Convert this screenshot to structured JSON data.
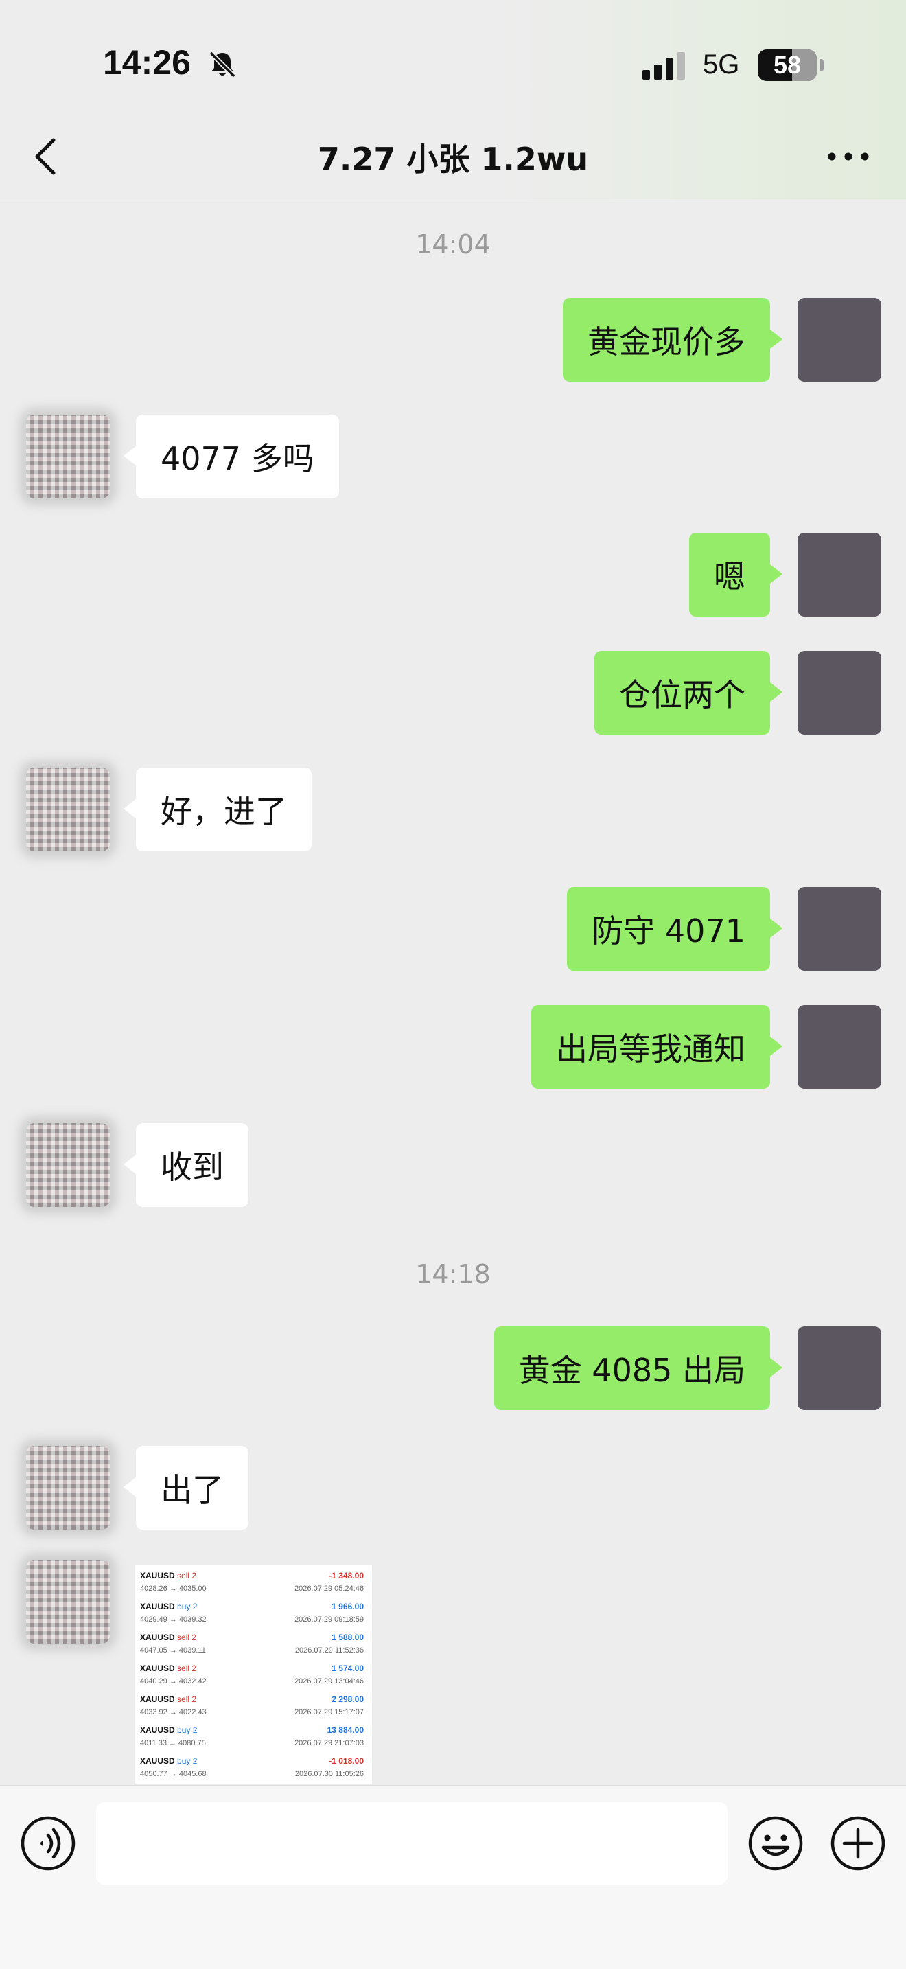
{
  "status_bar": {
    "time": "14:26",
    "network": "5G",
    "battery": "58",
    "battery_level": 0.58,
    "icons": [
      "bell-slash-icon",
      "signal-icon"
    ]
  },
  "nav": {
    "title": "7.27 小张 1.2wu",
    "back_icon": "chevron-left-icon",
    "more_icon": "ellipsis-icon"
  },
  "colors": {
    "self_bubble": "#95ec69",
    "other_bubble": "#ffffff",
    "background": "#ededed",
    "loss": "#d0312d",
    "profit": "#1e6fd9"
  },
  "timestamps": [
    "14:04",
    "14:18"
  ],
  "messages": [
    {
      "from": "self",
      "text": "黄金现价多"
    },
    {
      "from": "other",
      "text": "4077 多吗"
    },
    {
      "from": "self",
      "text": "嗯"
    },
    {
      "from": "self",
      "text": "仓位两个"
    },
    {
      "from": "other",
      "text": "好，进了"
    },
    {
      "from": "self",
      "text": "防守 4071"
    },
    {
      "from": "self",
      "text": "出局等我通知"
    },
    {
      "from": "other",
      "text": "收到"
    },
    {
      "from": "self",
      "text": "黄金 4085 出局"
    },
    {
      "from": "other",
      "text": "出了"
    }
  ],
  "trades": [
    {
      "symbol": "XAUUSD",
      "side": "sell 2",
      "dir": "sell",
      "prices": "4028.26 → 4035.00",
      "pnl": "-1 348.00",
      "time": "2026.07.29 05:24:46"
    },
    {
      "symbol": "XAUUSD",
      "side": "buy 2",
      "dir": "buy",
      "prices": "4029.49 → 4039.32",
      "pnl": "1 966.00",
      "time": "2026.07.29 09:18:59"
    },
    {
      "symbol": "XAUUSD",
      "side": "sell 2",
      "dir": "sell",
      "prices": "4047.05 → 4039.11",
      "pnl": "1 588.00",
      "time": "2026.07.29 11:52:36"
    },
    {
      "symbol": "XAUUSD",
      "side": "sell 2",
      "dir": "sell",
      "prices": "4040.29 → 4032.42",
      "pnl": "1 574.00",
      "time": "2026.07.29 13:04:46"
    },
    {
      "symbol": "XAUUSD",
      "side": "sell 2",
      "dir": "sell",
      "prices": "4033.92 → 4022.43",
      "pnl": "2 298.00",
      "time": "2026.07.29 15:17:07"
    },
    {
      "symbol": "XAUUSD",
      "side": "buy 2",
      "dir": "buy",
      "prices": "4011.33 → 4080.75",
      "pnl": "13 884.00",
      "time": "2026.07.29 21:07:03"
    },
    {
      "symbol": "XAUUSD",
      "side": "buy 2",
      "dir": "buy",
      "prices": "4050.77 → 4045.68",
      "pnl": "-1 018.00",
      "time": "2026.07.30 11:05:26"
    }
  ],
  "input_bar": {
    "voice_icon": "voice-icon",
    "emoji_icon": "emoji-icon",
    "plus_icon": "plus-circle-icon",
    "text_value": ""
  }
}
